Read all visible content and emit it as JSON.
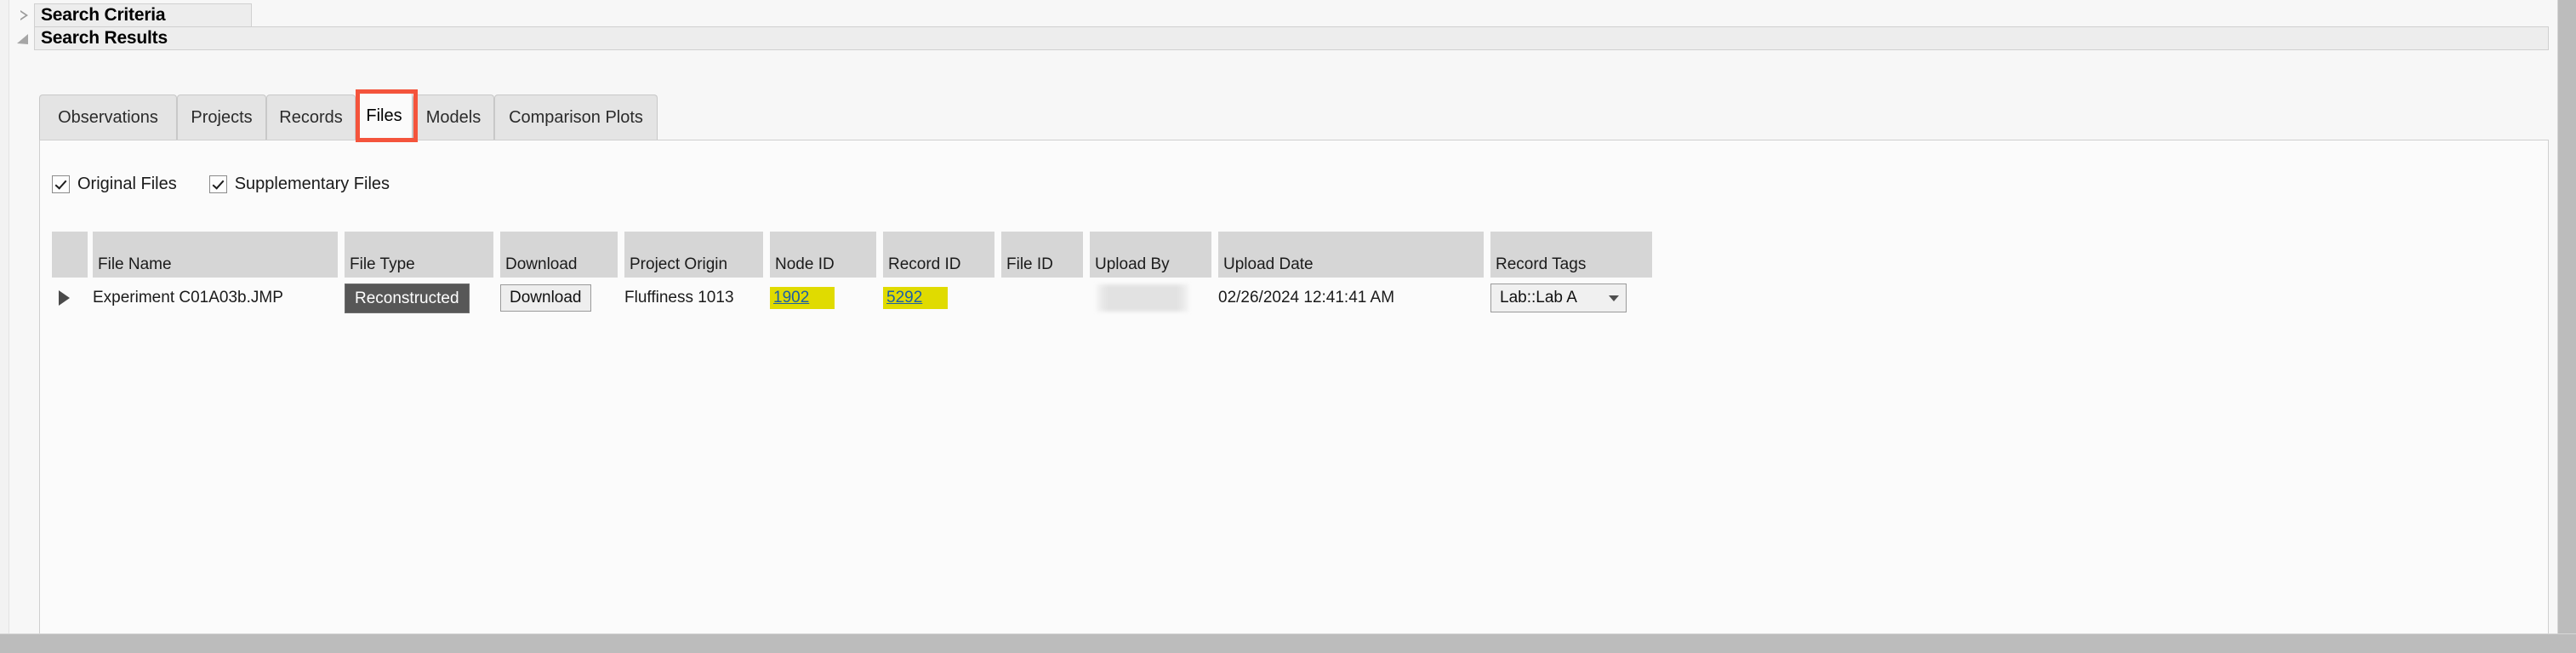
{
  "sections": {
    "search_criteria": {
      "title": "Search Criteria",
      "state": "collapsed"
    },
    "search_results": {
      "title": "Search Results",
      "state": "expanded"
    }
  },
  "tabs": [
    {
      "label": "Observations",
      "active": false
    },
    {
      "label": "Projects",
      "active": false
    },
    {
      "label": "Records",
      "active": false
    },
    {
      "label": "Files",
      "active": true
    },
    {
      "label": "Models",
      "active": false
    },
    {
      "label": "Comparison Plots",
      "active": false
    }
  ],
  "annotation": {
    "color": "#f4543c",
    "target": "Files"
  },
  "filters": [
    {
      "label": "Original Files",
      "checked": true
    },
    {
      "label": "Supplementary Files",
      "checked": true
    }
  ],
  "table": {
    "columns": [
      {
        "key": "expander",
        "label": ""
      },
      {
        "key": "file_name",
        "label": "File Name"
      },
      {
        "key": "file_type",
        "label": "File Type"
      },
      {
        "key": "download",
        "label": "Download"
      },
      {
        "key": "project_origin",
        "label": "Project Origin"
      },
      {
        "key": "node_id",
        "label": "Node ID"
      },
      {
        "key": "record_id",
        "label": "Record ID"
      },
      {
        "key": "file_id",
        "label": "File ID"
      },
      {
        "key": "upload_by",
        "label": "Upload By"
      },
      {
        "key": "upload_date",
        "label": "Upload Date"
      },
      {
        "key": "record_tags",
        "label": "Record Tags"
      }
    ],
    "rows": [
      {
        "file_name": "Experiment C01A03b.JMP",
        "file_type": "Reconstructed",
        "download": "Download",
        "project_origin": "Fluffiness 1013",
        "node_id": "1902",
        "record_id": "5292",
        "file_id": "",
        "upload_by": "",
        "upload_date": "02/26/2024 12:41:41 AM",
        "record_tags": "Lab::Lab A"
      }
    ]
  },
  "colors": {
    "highlight_yellow": "#e0db00",
    "link_blue": "#1b5ea6",
    "annotation_red": "#f4543c",
    "badge_dark": "#575757"
  }
}
